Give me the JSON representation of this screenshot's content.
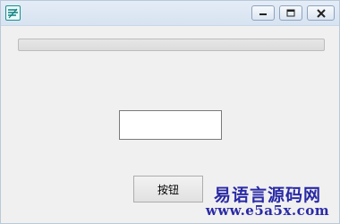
{
  "window": {
    "icon": "app-logo-icon",
    "controls": {
      "minimize_icon": "minimize-icon",
      "maximize_icon": "maximize-icon",
      "close_icon": "close-icon"
    }
  },
  "progress": {
    "value": 0
  },
  "textbox": {
    "value": ""
  },
  "button": {
    "label": "按钮"
  },
  "watermark": {
    "line1": "易语言源码网",
    "line2": "www.e5a5x.com"
  },
  "colors": {
    "window_bg": "#f0f0f0",
    "titlebar": "#d7e3f1",
    "watermark": "#2a2aa6",
    "progress_fill": "#06b025"
  }
}
